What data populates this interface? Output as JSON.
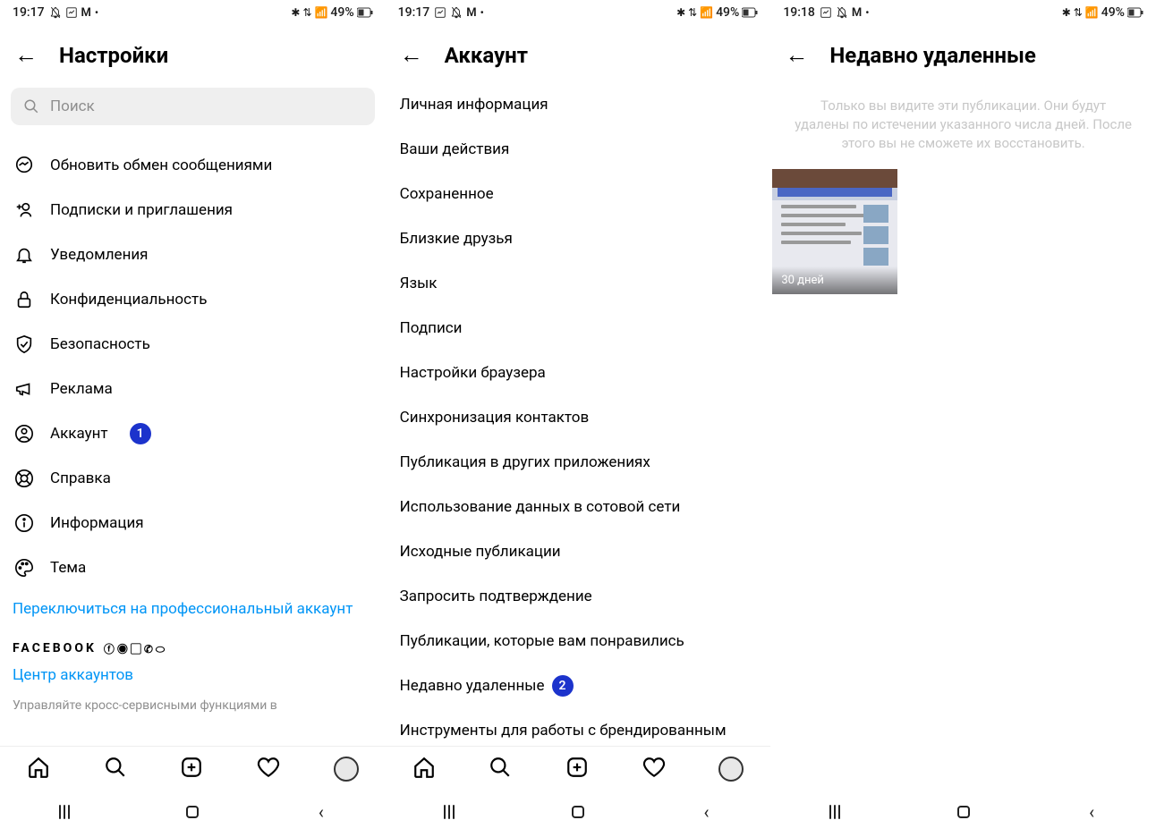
{
  "screen1": {
    "status": {
      "time": "19:17",
      "battery": "49%"
    },
    "title": "Настройки",
    "search_placeholder": "Поиск",
    "items": [
      "Обновить обмен сообщениями",
      "Подписки и приглашения",
      "Уведомления",
      "Конфиденциальность",
      "Безопасность",
      "Реклама",
      "Аккаунт",
      "Справка",
      "Информация",
      "Тема"
    ],
    "account_badge": "1",
    "link_pro": "Переключиться на профессиональный аккаунт",
    "fb_label": "FACEBOOK",
    "link_center": "Центр аккаунтов",
    "footer_muted": "Управляйте кросс-сервисными функциями в"
  },
  "screen2": {
    "status": {
      "time": "19:17",
      "battery": "49%"
    },
    "title": "Аккаунт",
    "items": [
      "Личная информация",
      "Ваши действия",
      "Сохраненное",
      "Близкие друзья",
      "Язык",
      "Подписи",
      "Настройки браузера",
      "Синхронизация контактов",
      "Публикация в других приложениях",
      "Использование данных в сотовой сети",
      "Исходные публикации",
      "Запросить подтверждение",
      "Публикации, которые вам понравились",
      "Недавно удаленные",
      "Инструменты для работы с брендированным"
    ],
    "deleted_badge": "2"
  },
  "screen3": {
    "status": {
      "time": "19:18",
      "battery": "49%"
    },
    "title": "Недавно удаленные",
    "info_text": "Только вы видите эти публикации. Они будут удалены по истечении указанного числа дней. После этого вы не сможете их восстановить.",
    "thumb_label": "30 дней"
  }
}
